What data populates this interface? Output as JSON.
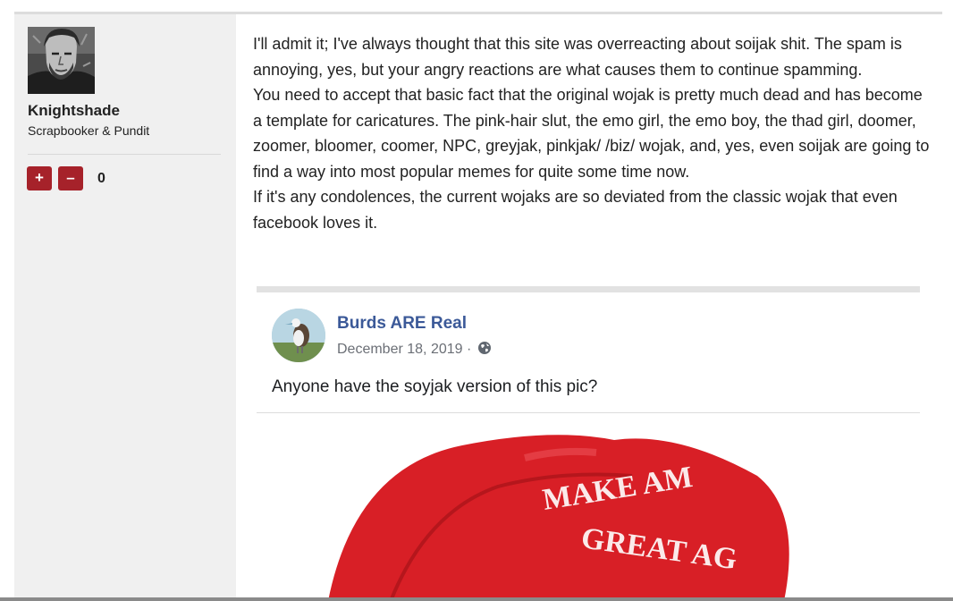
{
  "author": {
    "username": "Knightshade",
    "title": "Scrapbooker & Pundit"
  },
  "votes": {
    "up_label": "+",
    "down_label": "–",
    "score": "0"
  },
  "post": {
    "paragraphs": [
      "I'll admit it; I've always thought that this site was overreacting about soijak shit. The spam is annoying, yes, but your angry reactions are what causes them to continue spamming.",
      "You need to accept that basic fact that the original wojak is pretty much dead and has become a template for caricatures. The pink-hair slut, the emo girl, the emo boy, the thad girl, doomer, zoomer, bloomer, coomer, NPC, greyjak, pinkjak/ /biz/ wojak, and, yes, even soijak are going to find a way into most popular memes for quite some time now.",
      "If it's any condolences, the current wojaks are so deviated from the classic wojak that even facebook loves it."
    ]
  },
  "embed": {
    "page_name": "Burds ARE Real",
    "date": "December 18, 2019 ·",
    "text": "Anyone have the soyjak version of this pic?",
    "hat_text": [
      "MAKE AM",
      "GREAT AG"
    ]
  },
  "colors": {
    "vote_button": "#a6222a",
    "link_blue": "#3b5998",
    "hat_red": "#d81f26"
  },
  "icons": [
    "avatar",
    "plus-icon",
    "minus-icon",
    "globe-icon",
    "bird-avatar"
  ]
}
